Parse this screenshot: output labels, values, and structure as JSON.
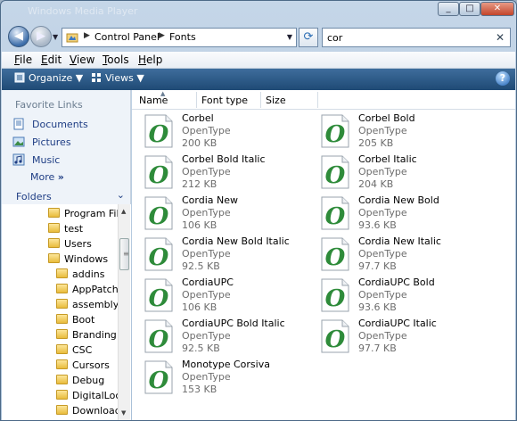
{
  "window": {
    "title": "Windows Media Player"
  },
  "address": {
    "segments": [
      "Control Panel",
      "Fonts"
    ]
  },
  "search": {
    "value": "cor"
  },
  "menu": {
    "items": [
      {
        "key": "F",
        "rest": "ile"
      },
      {
        "key": "E",
        "rest": "dit"
      },
      {
        "key": "V",
        "rest": "iew"
      },
      {
        "key": "T",
        "rest": "ools"
      },
      {
        "key": "H",
        "rest": "elp"
      }
    ]
  },
  "toolbar": {
    "organize": "Organize",
    "views": "Views"
  },
  "nav": {
    "favorites_heading": "Favorite Links",
    "links": [
      "Documents",
      "Pictures",
      "Music"
    ],
    "more": "More",
    "folders_heading": "Folders",
    "tree": [
      {
        "label": "Program File",
        "level": 0
      },
      {
        "label": "test",
        "level": 0
      },
      {
        "label": "Users",
        "level": 0
      },
      {
        "label": "Windows",
        "level": 0
      },
      {
        "label": "addins",
        "level": 1
      },
      {
        "label": "AppPatch",
        "level": 1
      },
      {
        "label": "assembly",
        "level": 1
      },
      {
        "label": "Boot",
        "level": 1
      },
      {
        "label": "Branding",
        "level": 1
      },
      {
        "label": "CSC",
        "level": 1
      },
      {
        "label": "Cursors",
        "level": 1
      },
      {
        "label": "Debug",
        "level": 1
      },
      {
        "label": "DigitalLock",
        "level": 1
      },
      {
        "label": "Download",
        "level": 1
      }
    ]
  },
  "columns": [
    "Name",
    "Font type",
    "Size"
  ],
  "fonts": [
    {
      "name": "Corbel",
      "type": "OpenType",
      "size": "200 KB"
    },
    {
      "name": "Corbel Bold",
      "type": "OpenType",
      "size": "205 KB"
    },
    {
      "name": "Corbel Bold Italic",
      "type": "OpenType",
      "size": "212 KB"
    },
    {
      "name": "Corbel Italic",
      "type": "OpenType",
      "size": "204 KB"
    },
    {
      "name": "Cordia New",
      "type": "OpenType",
      "size": "106 KB"
    },
    {
      "name": "Cordia New Bold",
      "type": "OpenType",
      "size": "93.6 KB"
    },
    {
      "name": "Cordia New Bold Italic",
      "type": "OpenType",
      "size": "92.5 KB"
    },
    {
      "name": "Cordia New Italic",
      "type": "OpenType",
      "size": "97.7 KB"
    },
    {
      "name": "CordiaUPC",
      "type": "OpenType",
      "size": "106 KB"
    },
    {
      "name": "CordiaUPC Bold",
      "type": "OpenType",
      "size": "93.6 KB"
    },
    {
      "name": "CordiaUPC Bold Italic",
      "type": "OpenType",
      "size": "92.5 KB"
    },
    {
      "name": "CordiaUPC Italic",
      "type": "OpenType",
      "size": "97.7 KB"
    },
    {
      "name": "Monotype Corsiva",
      "type": "OpenType",
      "size": "153 KB"
    }
  ],
  "colors": {
    "accent": "#1e3d84",
    "command_bar": "#2b5a88",
    "opentype_green": "#2e8b3a"
  }
}
